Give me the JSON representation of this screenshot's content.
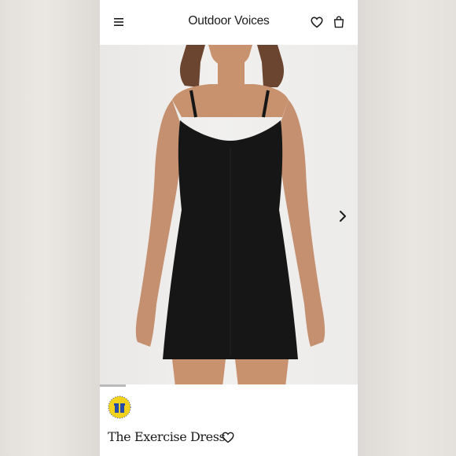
{
  "header": {
    "brand": "Outdoor Voices",
    "icons": [
      "menu-icon",
      "heart-icon",
      "bag-icon"
    ]
  },
  "gallery": {
    "image_subject": "model wearing black racerback exercise dress",
    "progress": 0.1,
    "next_icon": "chevron-right-icon"
  },
  "product": {
    "title": "The Exercise Dress",
    "badge_icon": "gift-badge-icon",
    "favorite_icon": "heart-icon"
  },
  "colors": {
    "background": "#e7e4e1",
    "page": "#ffffff",
    "text": "#1b1b1b",
    "dress": "#161616",
    "skin": "#c9926f",
    "hair": "#6b4530",
    "badge": "#f2d21b"
  }
}
